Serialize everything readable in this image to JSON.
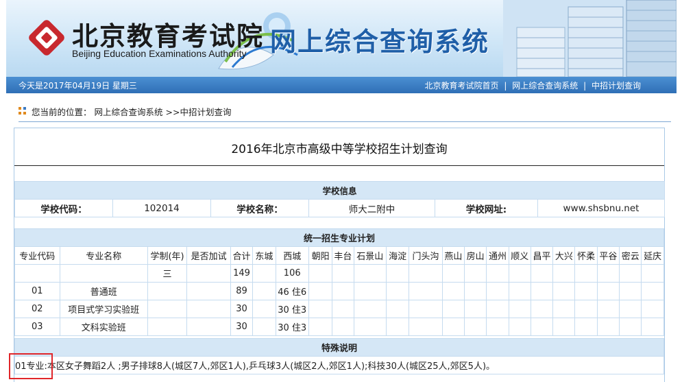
{
  "header": {
    "logo_cn": "北京教育考试院",
    "logo_en": "Beijing Education Examinations Authority",
    "system_title": "网上综合查询系统"
  },
  "navbar": {
    "date": "今天是2017年04月19日  星期三",
    "links": [
      "北京教育考试院首页",
      "网上综合查询系统",
      "中招计划查询"
    ],
    "separator": "|"
  },
  "breadcrumb": {
    "prefix": "您当前的位置：",
    "items": [
      "网上综合查询系统",
      ">>中招计划查询"
    ]
  },
  "page_title": "2016年北京市高级中等学校招生计划查询",
  "school_info": {
    "section": "学校信息",
    "code_label": "学校代码：",
    "code": "102014",
    "name_label": "学校名称：",
    "name": "师大二附中",
    "site_label": "学校网址:",
    "site": "www.shsbnu.net"
  },
  "plan": {
    "section": "统一招生专业计划",
    "columns": [
      "专业代码",
      "专业名称",
      "学制(年)",
      "是否加试",
      "合计",
      "东城",
      "西城",
      "朝阳",
      "丰台",
      "石景山",
      "海淀",
      "门头沟",
      "燕山",
      "房山",
      "通州",
      "顺义",
      "昌平",
      "大兴",
      "怀柔",
      "平谷",
      "密云",
      "延庆"
    ],
    "rows": [
      [
        "",
        "",
        "三",
        "",
        "149",
        "",
        "106",
        "",
        "",
        "",
        "",
        "",
        "",
        "",
        "",
        "",
        "",
        "",
        "",
        "",
        "",
        ""
      ],
      [
        "01",
        "普通班",
        "",
        "",
        "89",
        "",
        "46 住6",
        "",
        "",
        "",
        "",
        "",
        "",
        "",
        "",
        "",
        "",
        "",
        "",
        "",
        "",
        ""
      ],
      [
        "02",
        "项目式学习实验班",
        "",
        "",
        "30",
        "",
        "30 住3",
        "",
        "",
        "",
        "",
        "",
        "",
        "",
        "",
        "",
        "",
        "",
        "",
        "",
        "",
        ""
      ],
      [
        "03",
        "文科实验班",
        "",
        "",
        "30",
        "",
        "30 住3",
        "",
        "",
        "",
        "",
        "",
        "",
        "",
        "",
        "",
        "",
        "",
        "",
        "",
        "",
        ""
      ]
    ]
  },
  "special": {
    "section": "特殊说明",
    "text": "01专业:本区女子舞蹈2人 ;男子排球8人(城区7人,郊区1人),乒乓球3人(城区2人,郊区1人);科技30人(城区25人,郊区5人)。"
  },
  "colors": {
    "nav_bar": "#2f6fb6",
    "section_bg": "#d5e7f6",
    "title_blue": "#1f5fa8",
    "highlight_red": "#e0262a"
  }
}
